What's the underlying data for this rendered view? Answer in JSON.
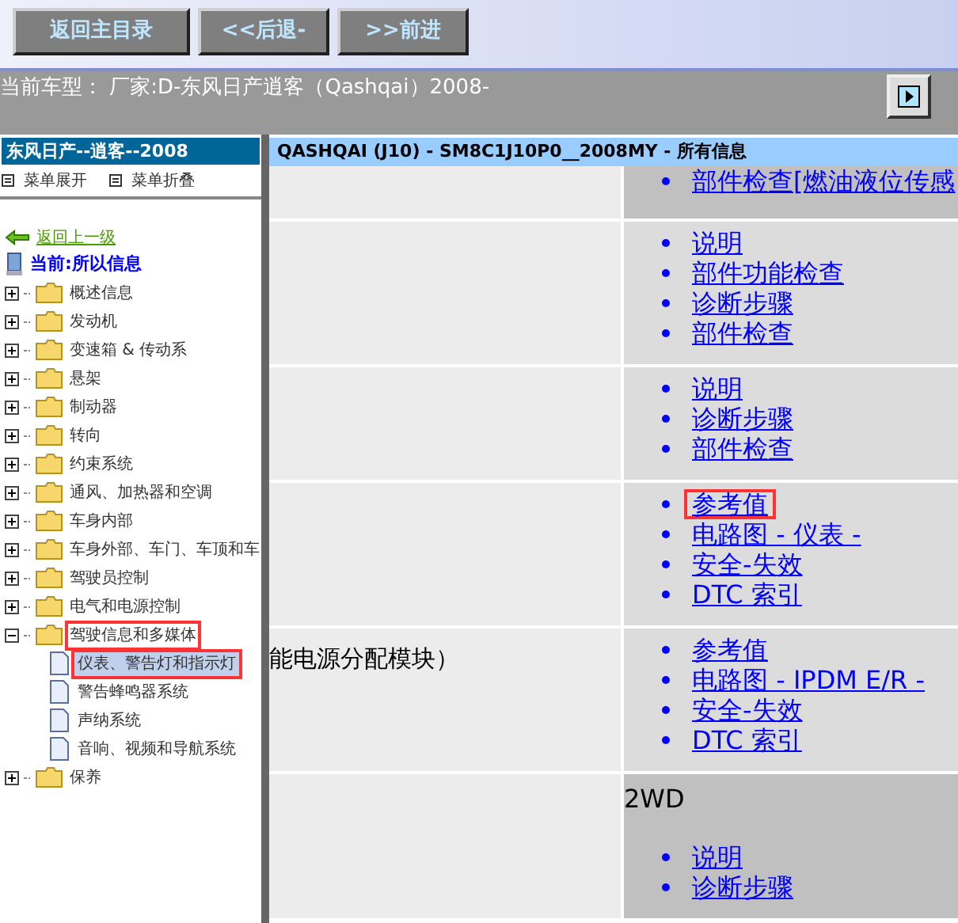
{
  "toolbar": {
    "buttons": [
      "返回主目录",
      "<<后退-",
      ">>前进"
    ]
  },
  "vehicle_bar": {
    "text": "当前车型： 厂家:D-东风日产逍客（Qashqai）2008-"
  },
  "sidebar": {
    "title": "东风日产--逍客--2008",
    "menu_actions": [
      "菜单展开",
      "菜单折叠"
    ],
    "back_link": "返回上一级",
    "current": "当前:所以信息",
    "tree": [
      {
        "label": "概述信息",
        "expanded": false,
        "selected": false,
        "highlighted": false
      },
      {
        "label": "发动机",
        "expanded": false,
        "selected": false,
        "highlighted": false
      },
      {
        "label": "变速箱 & 传动系",
        "expanded": false,
        "selected": false,
        "highlighted": false
      },
      {
        "label": "悬架",
        "expanded": false,
        "selected": false,
        "highlighted": false
      },
      {
        "label": "制动器",
        "expanded": false,
        "selected": false,
        "highlighted": false
      },
      {
        "label": "转向",
        "expanded": false,
        "selected": false,
        "highlighted": false
      },
      {
        "label": "约束系统",
        "expanded": false,
        "selected": false,
        "highlighted": false
      },
      {
        "label": "通风、加热器和空调",
        "expanded": false,
        "selected": false,
        "highlighted": false
      },
      {
        "label": "车身内部",
        "expanded": false,
        "selected": false,
        "highlighted": false
      },
      {
        "label": "车身外部、车门、车顶和车",
        "expanded": false,
        "selected": false,
        "highlighted": false
      },
      {
        "label": "驾驶员控制",
        "expanded": false,
        "selected": false,
        "highlighted": false
      },
      {
        "label": "电气和电源控制",
        "expanded": false,
        "selected": false,
        "highlighted": false
      },
      {
        "label": "驾驶信息和多媒体",
        "expanded": true,
        "selected": false,
        "highlighted": true,
        "children": [
          {
            "label": "仪表、警告灯和指示灯",
            "selected": true,
            "highlighted": true
          },
          {
            "label": "警告蜂鸣器系统",
            "selected": false,
            "highlighted": false
          },
          {
            "label": "声纳系统",
            "selected": false,
            "highlighted": false
          },
          {
            "label": "音响、视频和导航系统",
            "selected": false,
            "highlighted": false
          }
        ]
      },
      {
        "label": "保养",
        "expanded": false,
        "selected": false,
        "highlighted": false
      }
    ]
  },
  "content": {
    "title": "QASHQAI (J10) - SM8C1J10P0__2008MY - 所有信息",
    "rows": [
      {
        "name": "",
        "shaded": true,
        "links": [
          {
            "text": "部件检查[燃油液位传感",
            "highlighted": false
          }
        ]
      },
      {
        "name": "",
        "shaded": false,
        "links": [
          {
            "text": "说明",
            "highlighted": false
          },
          {
            "text": "部件功能检查",
            "highlighted": false
          },
          {
            "text": "诊断步骤",
            "highlighted": false
          },
          {
            "text": "部件检查",
            "highlighted": false
          }
        ]
      },
      {
        "name": "",
        "shaded": false,
        "links": [
          {
            "text": "说明",
            "highlighted": false
          },
          {
            "text": "诊断步骤",
            "highlighted": false
          },
          {
            "text": "部件检查",
            "highlighted": false
          }
        ]
      },
      {
        "name": "",
        "shaded": false,
        "links": [
          {
            "text": "参考值",
            "highlighted": true
          },
          {
            "text": "电路图 - 仪表 -",
            "highlighted": false
          },
          {
            "text": "安全-失效",
            "highlighted": false
          },
          {
            "text": "DTC 索引",
            "highlighted": false
          }
        ]
      },
      {
        "name": "能电源分配模块）",
        "shaded": false,
        "links": [
          {
            "text": "参考值",
            "highlighted": false
          },
          {
            "text": "电路图 - IPDM E/R -",
            "highlighted": false
          },
          {
            "text": "安全-失效",
            "highlighted": false
          },
          {
            "text": "DTC 索引",
            "highlighted": false
          }
        ]
      },
      {
        "name": "",
        "shaded": true,
        "heading": "2WD",
        "links": [
          {
            "text": "说明",
            "highlighted": false
          },
          {
            "text": "诊断步骤",
            "highlighted": false
          }
        ]
      }
    ]
  }
}
